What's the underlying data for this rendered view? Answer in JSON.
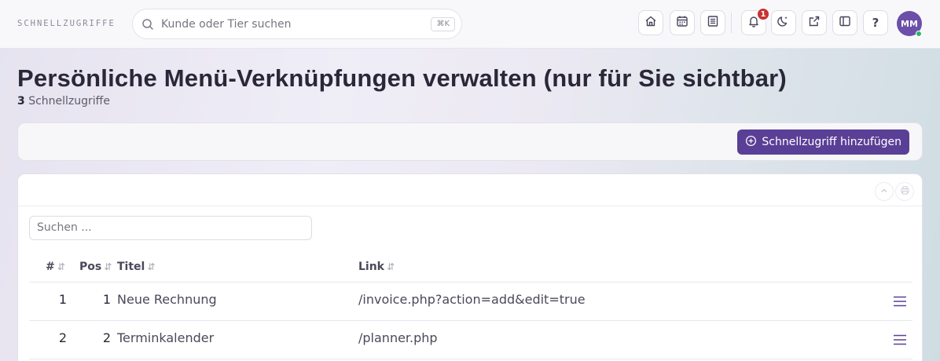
{
  "topbar": {
    "brand": "SCHNELLZUGRIFFE",
    "search_placeholder": "Kunde oder Tier suchen",
    "search_shortcut": "⌘K",
    "notification_count": "1",
    "help_label": "?",
    "avatar_initials": "MM",
    "icons": [
      "home-icon",
      "calendar-icon",
      "list-icon",
      "bell-icon",
      "moon-icon",
      "external-link-icon",
      "sidebar-icon",
      "help-icon"
    ]
  },
  "page": {
    "title": "Persönliche Menü-Verknüpfungen verwalten (nur für Sie sichtbar)",
    "count": "3",
    "count_label": "Schnellzugriffe"
  },
  "actions": {
    "add_label": "Schnellzugriff hinzufügen"
  },
  "table": {
    "filter_placeholder": "Suchen ...",
    "headers": {
      "id": "#",
      "pos": "Pos",
      "title": "Titel",
      "link": "Link"
    },
    "sort_glyph": "⇵",
    "rows": [
      {
        "id": "1",
        "pos": "1",
        "title": "Neue Rechnung",
        "link": "/invoice.php?action=add&edit=true"
      },
      {
        "id": "2",
        "pos": "2",
        "title": "Terminkalender",
        "link": "/planner.php"
      }
    ]
  },
  "colors": {
    "accent": "#5a3f96",
    "badge": "#c9322f",
    "online": "#2fb36b"
  }
}
